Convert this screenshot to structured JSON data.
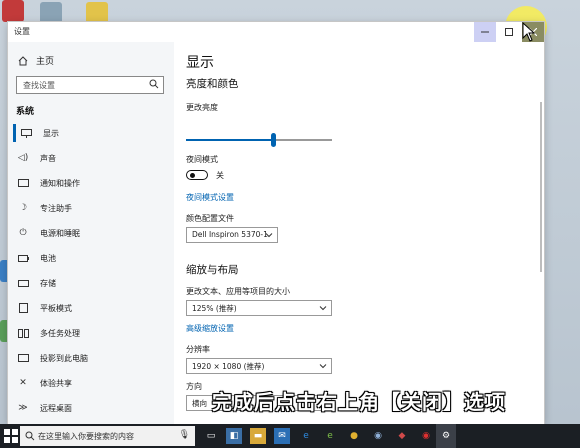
{
  "window": {
    "title": "设置"
  },
  "nav": {
    "home": "主页",
    "search_placeholder": "查找设置",
    "section": "系统",
    "items": [
      {
        "label": "显示",
        "icon": "monitor-icon"
      },
      {
        "label": "声音",
        "icon": "speaker-icon"
      },
      {
        "label": "通知和操作",
        "icon": "notification-icon"
      },
      {
        "label": "专注助手",
        "icon": "moon-icon"
      },
      {
        "label": "电源和睡眠",
        "icon": "power-icon"
      },
      {
        "label": "电池",
        "icon": "battery-icon"
      },
      {
        "label": "存储",
        "icon": "storage-icon"
      },
      {
        "label": "平板模式",
        "icon": "tablet-icon"
      },
      {
        "label": "多任务处理",
        "icon": "multitask-icon"
      },
      {
        "label": "投影到此电脑",
        "icon": "project-icon"
      },
      {
        "label": "体验共享",
        "icon": "share-icon"
      },
      {
        "label": "远程桌面",
        "icon": "remote-icon"
      }
    ]
  },
  "content": {
    "title": "显示",
    "section_brightness": "亮度和颜色",
    "brightness_label": "更改亮度",
    "brightness_value": 0.6,
    "night_label": "夜间模式",
    "night_state": "关",
    "night_link": "夜间模式设置",
    "color_profile_label": "颜色配置文件",
    "color_profile_value": "Dell Inspiron 5370-1",
    "section_scale": "缩放与布局",
    "scale_label": "更改文本、应用等项目的大小",
    "scale_value": "125% (推荐)",
    "scale_link": "高级缩放设置",
    "resolution_label": "分辨率",
    "resolution_value": "1920 × 1080 (推荐)",
    "orientation_label": "方向",
    "orientation_value": "横向"
  },
  "caption": "完成后点击右上角【关闭】选项",
  "taskbar": {
    "search_placeholder": "在这里输入你要搜索的内容"
  },
  "colors": {
    "accent": "#0063b1",
    "highlight": "#fff23c"
  }
}
